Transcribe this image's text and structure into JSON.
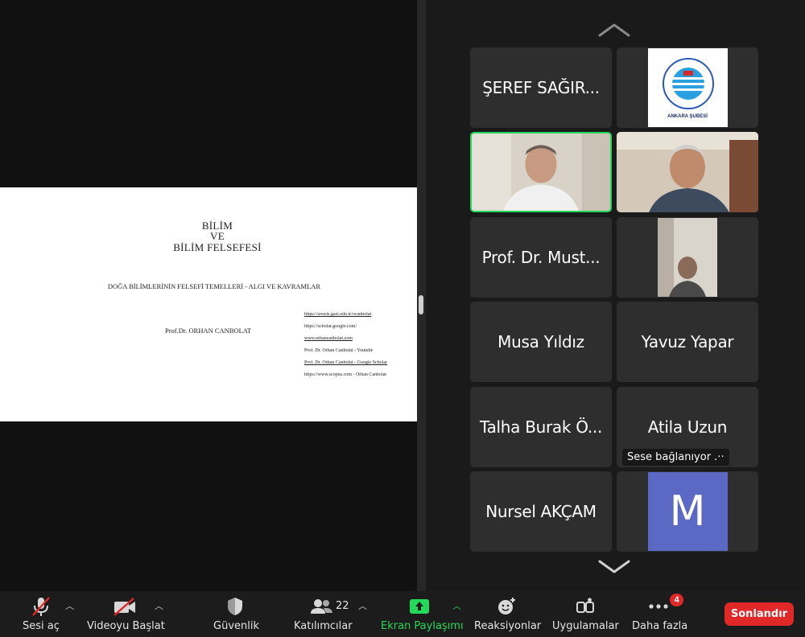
{
  "slide": {
    "title_line1": "BİLİM",
    "title_line2": "VE",
    "title_line3": "BİLİM FELSEFESİ",
    "subtitle": "DOĞA BİLİMLERİNİN FELSEFİ TEMELLERİ - ALGI VE KAVRAMLAR",
    "author": "Prof.Dr. ORHAN CANBOLAT",
    "links": [
      "https://avesis.gazi.edu.tr/ocanbolat",
      "https://scholar.google.com/",
      "www.orhancanbolat.com",
      "Prof. Dr. Orhan Canbolat - Youtube",
      "Prof. Dr. Orhan Canbolat - Google Scholar",
      "https://www.scopus.com - Orhan Canbolat"
    ]
  },
  "participants": {
    "seref": "ŞEREF SAĞIR...",
    "logo_text": "ANKARA ŞUBESİ",
    "prof": "Prof. Dr. Must...",
    "musa": "Musa Yıldız",
    "yavuz": "Yavuz Yapar",
    "talha": "Talha Burak Ö...",
    "atila": "Atila Uzun",
    "atila_status": "Sese bağlanıyor  .··",
    "nursel": "Nursel AKÇAM",
    "m_initial": "M"
  },
  "toolbar": {
    "audio": "Sesi aç",
    "video": "Videoyu Başlat",
    "security": "Güvenlik",
    "participants": "Katılımcılar",
    "participants_count": "22",
    "share": "Ekran Paylaşımı",
    "reactions": "Reaksiyonlar",
    "apps": "Uygulamalar",
    "more": "Daha fazla",
    "more_badge": "4",
    "end": "Sonlandır"
  },
  "colors": {
    "active_speaker": "#23d959",
    "end_button": "#e02828",
    "avatar_bg": "#5b68c4"
  }
}
